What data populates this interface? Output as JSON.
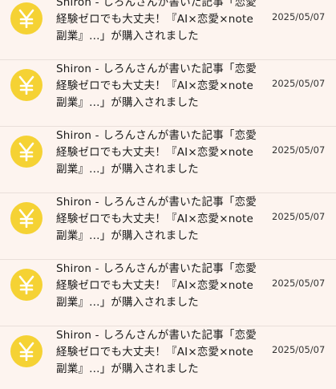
{
  "colors": {
    "background": "#fdf4ef",
    "coin": "#f5d234",
    "divider": "#e9dfda"
  },
  "notifications": [
    {
      "icon": "yen-coin-icon",
      "message": "Shiron - しろんさんが書いた記事「恋愛経験ゼロでも大丈夫！『AI×恋愛×note副業』...」が購入されました",
      "date": "2025/05/07"
    },
    {
      "icon": "yen-coin-icon",
      "message": "Shiron - しろんさんが書いた記事「恋愛経験ゼロでも大丈夫！『AI×恋愛×note副業』...」が購入されました",
      "date": "2025/05/07"
    },
    {
      "icon": "yen-coin-icon",
      "message": "Shiron - しろんさんが書いた記事「恋愛経験ゼロでも大丈夫！『AI×恋愛×note副業』...」が購入されました",
      "date": "2025/05/07"
    },
    {
      "icon": "yen-coin-icon",
      "message": "Shiron - しろんさんが書いた記事「恋愛経験ゼロでも大丈夫！『AI×恋愛×note副業』...」が購入されました",
      "date": "2025/05/07"
    },
    {
      "icon": "yen-coin-icon",
      "message": "Shiron - しろんさんが書いた記事「恋愛経験ゼロでも大丈夫！『AI×恋愛×note副業』...」が購入されました",
      "date": "2025/05/07"
    },
    {
      "icon": "yen-coin-icon",
      "message": "Shiron - しろんさんが書いた記事「恋愛経験ゼロでも大丈夫！『AI×恋愛×note副業』...」が購入されました",
      "date": "2025/05/07"
    }
  ]
}
